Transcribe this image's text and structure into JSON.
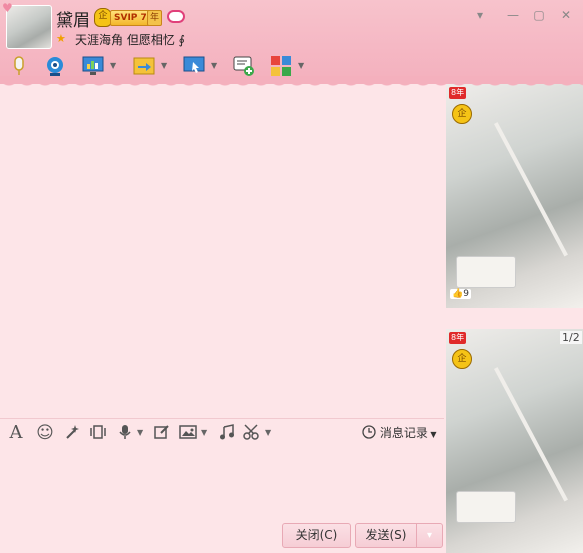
{
  "contact": {
    "name": "黛眉",
    "badge_qq": "企",
    "badge_svip": "SVIP 7",
    "badge_year": "年",
    "signature": "天涯海角 但愿相忆",
    "signature_suffix": "∮"
  },
  "window_controls": {
    "dropdown": "▾",
    "minimize": "—",
    "maximize": "▢",
    "close": "✕"
  },
  "toolbar_icons": [
    "microphone-icon",
    "camera-icon",
    "screen-share-icon",
    "file-transfer-icon",
    "remote-desktop-icon",
    "new-message-icon",
    "apps-icon"
  ],
  "input_toolbar": {
    "font_label": "A",
    "emoji": "☺",
    "history_label": "消息记录"
  },
  "buttons": {
    "close": "关闭(C)",
    "send": "发送(S)",
    "send_dropdown": "▾"
  },
  "side_panel": {
    "page_indicator": "1/2",
    "year_badge": "8年",
    "qq_badge": "企",
    "likes": "9"
  },
  "colors": {
    "titlebar": "#f5b8c4",
    "body": "#fde5e8",
    "button_border": "#e8a9b5"
  }
}
